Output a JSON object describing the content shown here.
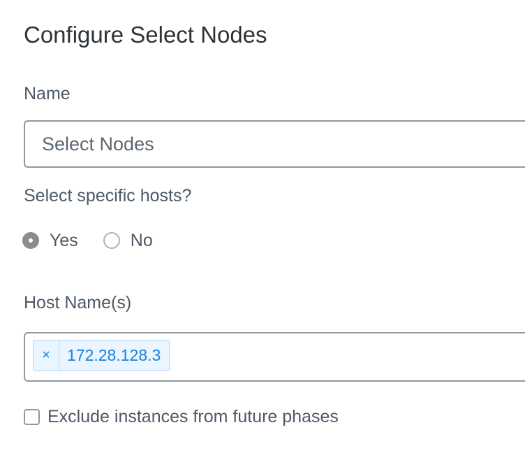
{
  "dialog": {
    "title": "Configure Select Nodes"
  },
  "name_field": {
    "label": "Name",
    "value": "Select Nodes",
    "placeholder": ""
  },
  "select_hosts": {
    "label": "Select specific hosts?",
    "options": [
      {
        "label": "Yes",
        "selected": true
      },
      {
        "label": "No",
        "selected": false
      }
    ]
  },
  "host_names": {
    "label": "Host Name(s)",
    "tags": [
      {
        "remove_symbol": "×",
        "value": "172.28.128.3"
      }
    ]
  },
  "exclude_checkbox": {
    "label": "Exclude instances from future phases",
    "checked": false
  },
  "colors": {
    "tag_text": "#1583e0",
    "tag_background": "#ebf5ff",
    "radio_selected": "#8c8c8c"
  },
  "icons": {
    "tag_remove": "close-icon"
  }
}
